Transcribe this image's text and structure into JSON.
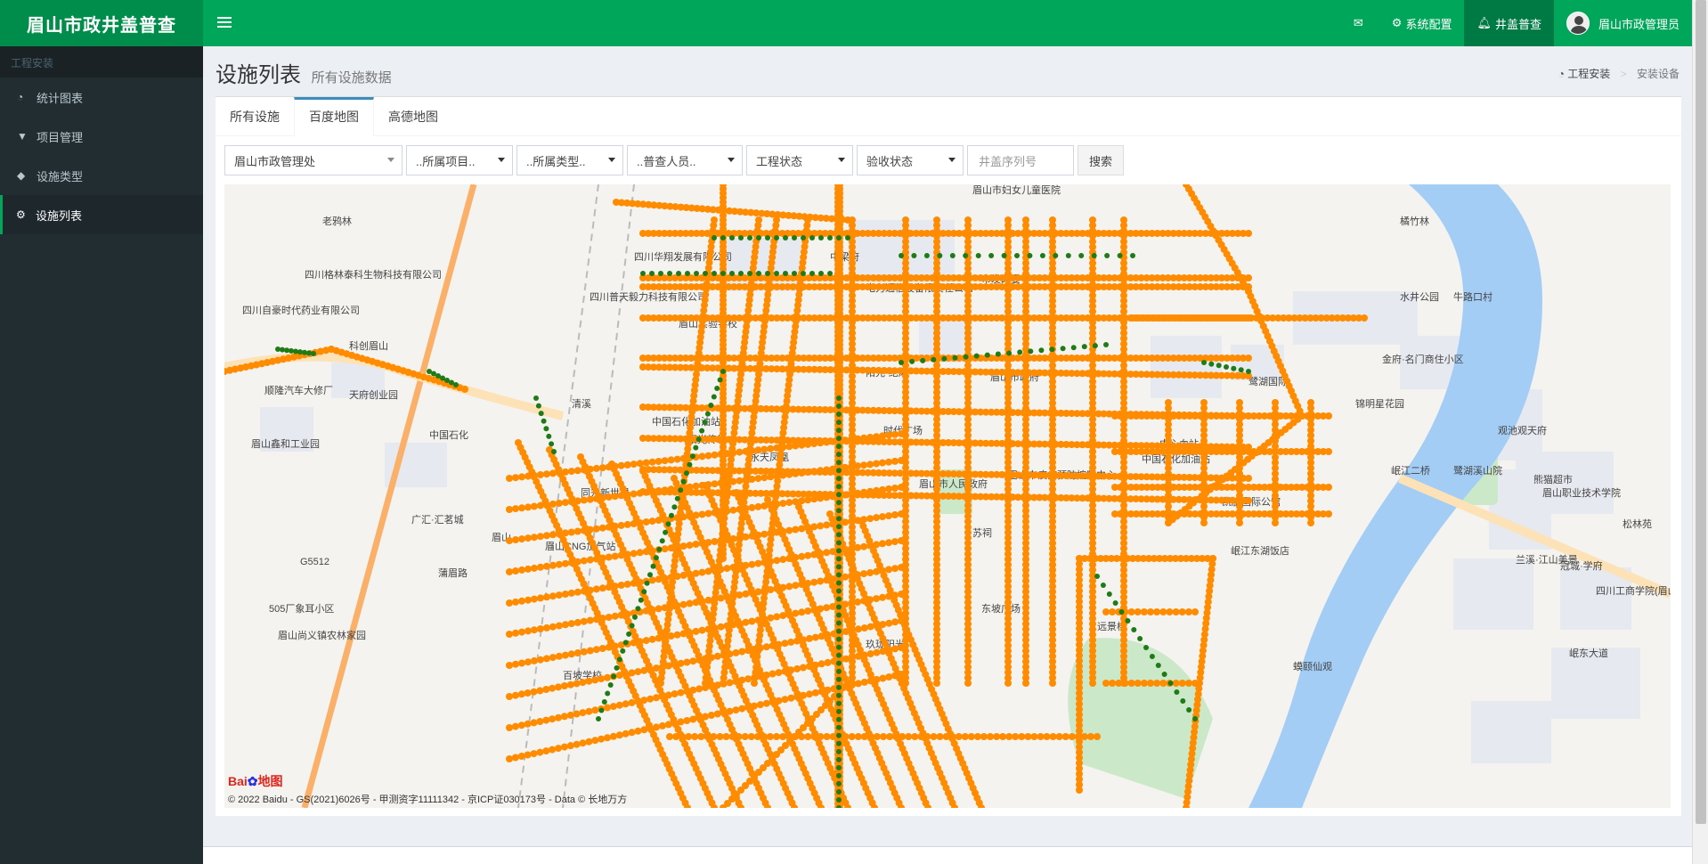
{
  "app": {
    "logo": "眉山市政井盖普查"
  },
  "navbar": {
    "mail_icon": "envelope-icon",
    "settings_label": "系统配置",
    "system_label": "井盖普查",
    "user_label": "眉山市政管理员"
  },
  "sidebar": {
    "header": "工程安装",
    "items": [
      {
        "label": "统计图表",
        "icon": "dashboard-icon"
      },
      {
        "label": "项目管理",
        "icon": "filter-icon"
      },
      {
        "label": "设施类型",
        "icon": "tags-icon"
      },
      {
        "label": "设施列表",
        "icon": "cogs-icon"
      }
    ]
  },
  "page": {
    "title": "设施列表",
    "subtitle": "所有设施数据"
  },
  "breadcrumb": {
    "home": "工程安装",
    "current": "安装设备"
  },
  "tabs": [
    "所有设施",
    "百度地图",
    "高德地图"
  ],
  "filters": {
    "dept": "眉山市政管理处",
    "project": "..所属项目..",
    "type": "..所属类型..",
    "inspector": "..普查人员..",
    "eng_status": "工程状态",
    "accept_status": "验收状态",
    "serial_placeholder": "井盖序列号",
    "search_label": "搜索"
  },
  "map": {
    "copyright": "© 2022 Baidu - GS(2021)6026号 - 甲测资字11111342 - 京ICP证030173号 - Data © 长地万方",
    "logo_text": "Bai",
    "logo_text2": "地图",
    "colors": {
      "background": "#f5f3f0",
      "block": "#e6e9ef",
      "river": "#a3cdf5",
      "park": "#cbe8c8",
      "highway": "#fbb06a",
      "manhole_unaccepted": "#ff8c00",
      "manhole_accepted": "#1e7b16"
    },
    "labels": [
      "老鸦林",
      "四川格林泰科生物科技有限公司",
      "四川自豪时代药业有限公司",
      "科创眉山",
      "顺隆汽车大修厂",
      "天府创业园",
      "中国石化",
      "眉山鑫和工业园",
      "四川华翔发展有限公司",
      "四川普天毅力科技有限公司",
      "中梁府",
      "眉山实验学校",
      "清溪",
      "中国石化加油站",
      "阳光传世",
      "永天凤凰",
      "同升新世界",
      "眉山",
      "眉山CNG加气站",
      "广汇·汇茗城",
      "505厂象耳小区",
      "眉山尚义镇农林家园",
      "蒲眉路",
      "眉山市妇女儿童医院",
      "电力通信设备限责任公司",
      "市发改委",
      "阳光·纪风",
      "眉山市政府",
      "眉山市人民政府",
      "时代广场",
      "眉山市疾病预防控制中心",
      "苏祠",
      "远景楼",
      "东坡广场",
      "玖珑阳光",
      "百坡学校",
      "鹭湖国际",
      "中心血站",
      "中国石化加油站",
      "凯旋国际公馆",
      "岷江东湖饭店",
      "金府·名门商住小区",
      "锦明星花园",
      "橘竹林",
      "牛路口村",
      "水井公园",
      "观池观天府",
      "鹭湖溪山院",
      "熊猫超市",
      "眉山职业技术学院",
      "松林苑",
      "兰溪·江山美景",
      "冠城·学府",
      "四川工商学院(眉山校区)",
      "岷江二桥",
      "岷东大道",
      "蟆颐仙观",
      "G5512"
    ]
  }
}
